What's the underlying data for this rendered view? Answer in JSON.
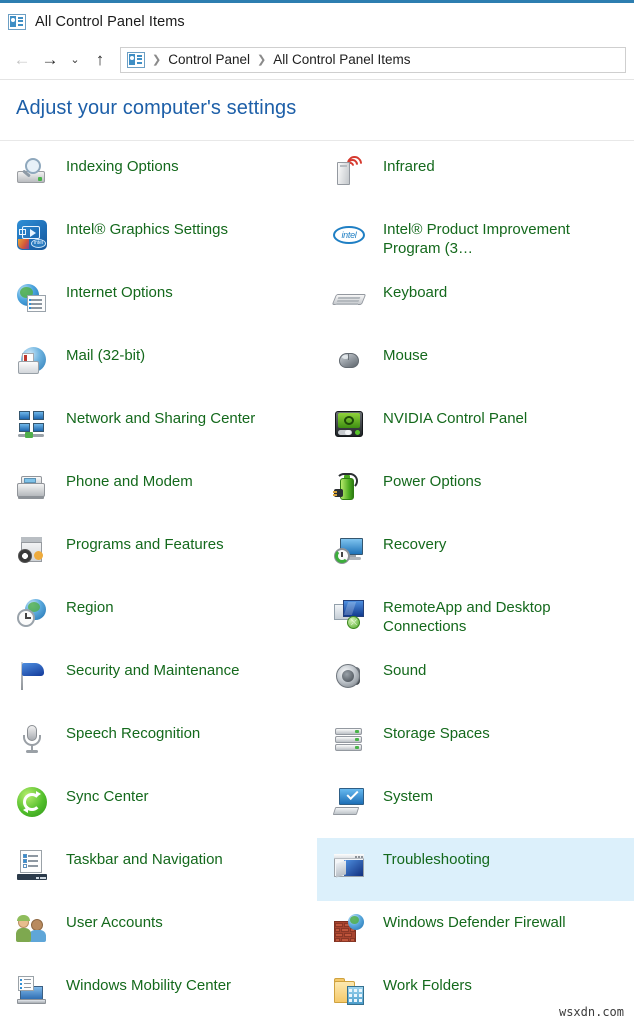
{
  "window": {
    "title": "All Control Panel Items",
    "title_icon": "control-panel-icon"
  },
  "nav": {
    "back_icon": "←",
    "forward_icon": "→",
    "history_icon": "⌄",
    "up_icon": "↑",
    "breadcrumb_icon": "control-panel-icon",
    "separator": "❯",
    "breadcrumbs": [
      "Control Panel",
      "All Control Panel Items"
    ]
  },
  "heading": "Adjust your computer's settings",
  "colors": {
    "accent_bar": "#2d7eb0",
    "heading_text": "#1d5fa8",
    "item_label": "#14691c",
    "selection_background": "#dcf0fb"
  },
  "items": {
    "left_column": [
      {
        "label": "Indexing Options",
        "icon": "indexing-options-icon",
        "selected": false
      },
      {
        "label": "Intel® Graphics Settings",
        "icon": "intel-graphics-settings-icon",
        "selected": false
      },
      {
        "label": "Internet Options",
        "icon": "internet-options-icon",
        "selected": false
      },
      {
        "label": "Mail (32-bit)",
        "icon": "mail-icon",
        "selected": false
      },
      {
        "label": "Network and Sharing Center",
        "icon": "network-sharing-center-icon",
        "selected": false
      },
      {
        "label": "Phone and Modem",
        "icon": "phone-and-modem-icon",
        "selected": false
      },
      {
        "label": "Programs and Features",
        "icon": "programs-and-features-icon",
        "selected": false
      },
      {
        "label": "Region",
        "icon": "region-icon",
        "selected": false
      },
      {
        "label": "Security and Maintenance",
        "icon": "security-and-maintenance-icon",
        "selected": false
      },
      {
        "label": "Speech Recognition",
        "icon": "speech-recognition-icon",
        "selected": false
      },
      {
        "label": "Sync Center",
        "icon": "sync-center-icon",
        "selected": false
      },
      {
        "label": "Taskbar and Navigation",
        "icon": "taskbar-and-navigation-icon",
        "selected": false
      },
      {
        "label": "User Accounts",
        "icon": "user-accounts-icon",
        "selected": false
      },
      {
        "label": "Windows Mobility Center",
        "icon": "windows-mobility-center-icon",
        "selected": false
      }
    ],
    "right_column": [
      {
        "label": "Infrared",
        "icon": "infrared-icon",
        "selected": false
      },
      {
        "label": "Intel® Product Improvement Program (3…",
        "icon": "intel-logo-icon",
        "selected": false
      },
      {
        "label": "Keyboard",
        "icon": "keyboard-icon",
        "selected": false
      },
      {
        "label": "Mouse",
        "icon": "mouse-icon",
        "selected": false
      },
      {
        "label": "NVIDIA Control Panel",
        "icon": "nvidia-control-panel-icon",
        "selected": false
      },
      {
        "label": "Power Options",
        "icon": "power-options-icon",
        "selected": false
      },
      {
        "label": "Recovery",
        "icon": "recovery-icon",
        "selected": false
      },
      {
        "label": "RemoteApp and Desktop Connections",
        "icon": "remoteapp-icon",
        "selected": false
      },
      {
        "label": "Sound",
        "icon": "sound-icon",
        "selected": false
      },
      {
        "label": "Storage Spaces",
        "icon": "storage-spaces-icon",
        "selected": false
      },
      {
        "label": "System",
        "icon": "system-icon",
        "selected": false
      },
      {
        "label": "Troubleshooting",
        "icon": "troubleshooting-icon",
        "selected": true
      },
      {
        "label": "Windows Defender Firewall",
        "icon": "windows-defender-firewall-icon",
        "selected": false
      },
      {
        "label": "Work Folders",
        "icon": "work-folders-icon",
        "selected": false
      }
    ]
  },
  "watermark": "wsxdn.com"
}
